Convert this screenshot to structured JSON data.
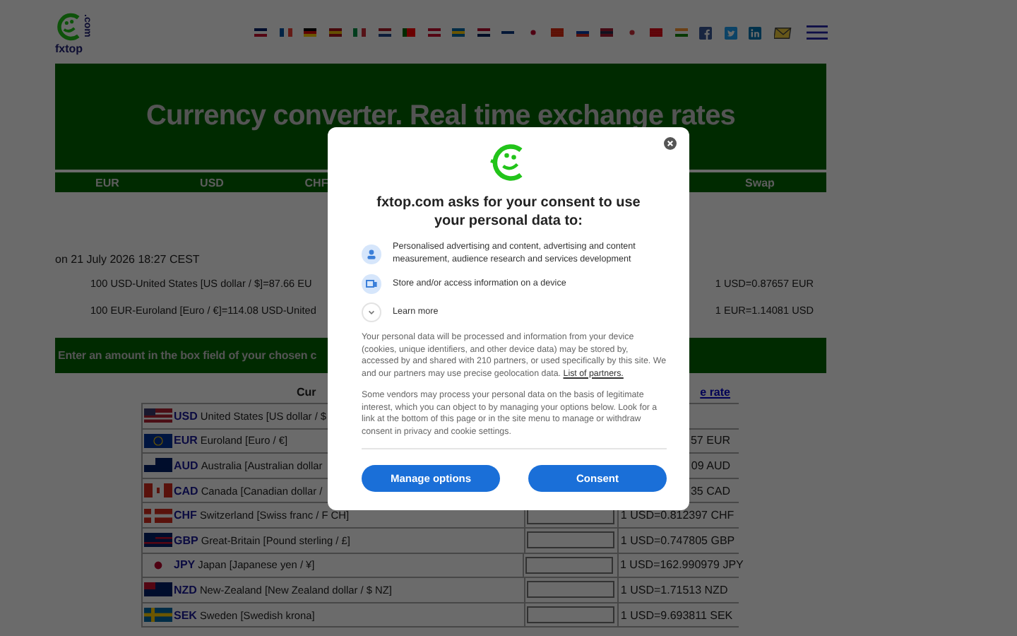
{
  "header": {
    "logo_text": "fxtop",
    "logo_domain": ".com"
  },
  "banner": {
    "title": "Currency converter. Real time exchange rates"
  },
  "nav": [
    {
      "label": "EUR"
    },
    {
      "label": "USD"
    },
    {
      "label": "CHF"
    },
    {
      "label": "Swap"
    }
  ],
  "date": "on 21 July 2026 18:27 CEST",
  "rates": [
    {
      "left": "100 USD-United States [US dollar / $]=87.66 EU",
      "right": "1 USD=0.87657 EUR"
    },
    {
      "left": "100 EUR-Euroland [Euro / €]=114.08 USD-United",
      "right": "1 EUR=1.14081 USD"
    }
  ],
  "instruction": "Enter an amount in the box field of your chosen c",
  "table": {
    "column_1": "Cur",
    "column_3": "e rate",
    "rows": [
      {
        "code": "USD",
        "name": "United States [US dollar / $"
      },
      {
        "code": "EUR",
        "name": "Euroland [Euro / €]",
        "rate": "57 EUR",
        "clipped": true
      },
      {
        "code": "AUD",
        "name": "Australia [Australian dollar",
        "rate": "09 AUD",
        "clipped": true
      },
      {
        "code": "CAD",
        "name": "Canada [Canadian dollar /",
        "rate": "35 CAD",
        "clipped": true
      },
      {
        "code": "CHF",
        "name": "Switzerland [Swiss franc / F CH]",
        "rate": "1 USD=0.812397 CHF",
        "clipped": false
      },
      {
        "code": "GBP",
        "name": "Great-Britain [Pound sterling / £]",
        "rate": "1 USD=0.747805 GBP",
        "clipped": false
      },
      {
        "code": "JPY",
        "name": "Japan [Japanese yen / ¥]",
        "rate": "1 USD=162.990979 JPY",
        "clipped": false
      },
      {
        "code": "NZD",
        "name": "New-Zealand [New Zealand dollar / $ NZ]",
        "rate": "1 USD=1.71513 NZD",
        "clipped": false
      },
      {
        "code": "SEK",
        "name": "Sweden [Swedish krona]",
        "rate": "1 USD=9.693811 SEK",
        "clipped": false
      }
    ]
  },
  "consent": {
    "title": "fxtop.com asks for your consent to use your personal data to:",
    "purposes": [
      {
        "kind": "person",
        "text": "Personalised advertising and content, advertising and content measurement, audience research and services development"
      },
      {
        "kind": "device",
        "text": "Store and/or access information on a device"
      }
    ],
    "learn_more": "Learn more",
    "paragraph_1": "Your personal data will be processed and information from your device (cookies, unique identifiers, and other device data) may be stored by, accessed by and shared with 210 partners, or used specifically by this site. We and our partners may use precise geolocation data.",
    "partners_link": "List of partners.",
    "paragraph_2": "Some vendors may process your personal data on the basis of legitimate interest, which you can object to by managing your options below. Look for a link at the bottom of this page or in the site menu to manage or withdraw consent in privacy and cookie settings.",
    "buttons": [
      "Manage options",
      "Consent"
    ]
  }
}
